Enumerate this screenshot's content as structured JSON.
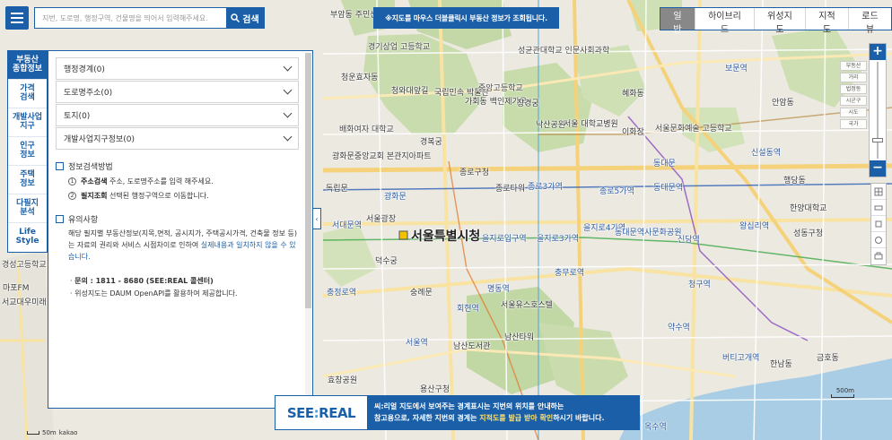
{
  "search": {
    "placeholder": "지번, 도로명, 행정구역, 건물명을 띄어서 입력해주세요.",
    "value": "",
    "button_label": "검색"
  },
  "top_notice": "※지도를 마우스 더블클릭시 부동산 정보가 조회됩니다.",
  "map_types": [
    {
      "label": "일반",
      "active": true
    },
    {
      "label": "하이브리드",
      "active": false
    },
    {
      "label": "위성지도",
      "active": false
    },
    {
      "label": "지적도",
      "active": false
    },
    {
      "label": "로드뷰",
      "active": false
    }
  ],
  "sidebar": {
    "items": [
      {
        "label": "부동산\n종합정보",
        "active": true
      },
      {
        "label": "가격\n검색",
        "active": false
      },
      {
        "label": "개발사업\n지구",
        "active": false
      },
      {
        "label": "인구\n정보",
        "active": false
      },
      {
        "label": "주택\n정보",
        "active": false
      },
      {
        "label": "다필지\n분석",
        "active": false
      },
      {
        "label": "Life\nStyle",
        "active": false
      }
    ]
  },
  "panel": {
    "accordions": [
      "행정경계(0)",
      "도로명주소(0)",
      "토지(0)",
      "개발사업지구정보(0)"
    ],
    "search_method": {
      "title": "정보검색방법",
      "steps": [
        {
          "num": "1",
          "bold": "주소검색",
          "text": " 주소, 도로명주소를 입력 해주세요."
        },
        {
          "num": "2",
          "bold": "필지조회",
          "text": " 선택된 행정구역으로 이동합니다."
        }
      ]
    },
    "caution": {
      "title": "유의사항",
      "text": "해당 필지별 부동산정보(지목,면적, 공시지가, 주택공시가격, 건축물 정보 등)는 자료의 권리와 서비스 시점차이로 인하여 ",
      "highlight": "실제내용과 일치하지 않을 수 있습니다.",
      "bullets": [
        "문의 : 1811 - 8680 (SEE:REAL 콜센터)",
        "위성지도는 DAUM OpenAPI를 활용하여 제공합니다."
      ]
    }
  },
  "banner": {
    "logo_prefix": "SEE",
    "logo_colon": ":",
    "logo_suffix": "REAL",
    "line1": "씨:리얼 지도에서 보여주는 경계표시는 지번의 위치를 안내하는",
    "line2_a": "참고용으로, 자세한 지번의 경계는 ",
    "line2_em": "지적도를 발급 받아 확인",
    "line2_b": "하시기 바랍니다."
  },
  "zoom_levels": [
    "부동산",
    "거리",
    "법정동",
    "시군구",
    "시도",
    "국가"
  ],
  "scale": {
    "left": "50m",
    "left_brand": "kakao",
    "right": "500m"
  },
  "map_labels": [
    {
      "text": "서울특별시청",
      "cls": "big"
    },
    {
      "text": "부암동\n주민센터"
    },
    {
      "text": "경기상업\n고등학교"
    },
    {
      "text": "청운효자동"
    },
    {
      "text": "청와대앞길"
    },
    {
      "text": "국립민속\n박물관"
    },
    {
      "text": "가회동\n백인제가옥"
    },
    {
      "text": "중앙고등학교"
    },
    {
      "text": "성균관대학교\n인문사회과학"
    },
    {
      "text": "혜화동"
    },
    {
      "text": "창경궁"
    },
    {
      "text": "낙산공원"
    },
    {
      "text": "서울\n대학교병원"
    },
    {
      "text": "이화장"
    },
    {
      "text": "서울문화예술\n고등학교"
    },
    {
      "text": "동대문"
    },
    {
      "text": "경복궁"
    },
    {
      "text": "배화여자\n대학교"
    },
    {
      "text": "광화문"
    },
    {
      "text": "광화문중앙교회\n본관지아파트"
    },
    {
      "text": "종로구청"
    },
    {
      "text": "종로3가역"
    },
    {
      "text": "종로타워"
    },
    {
      "text": "종로5가역"
    },
    {
      "text": "동대문역"
    },
    {
      "text": "서울광장"
    },
    {
      "text": "덕수궁"
    },
    {
      "text": "을지로입구역"
    },
    {
      "text": "을지로3가역"
    },
    {
      "text": "을지로4가역"
    },
    {
      "text": "동대문역사문화공원"
    },
    {
      "text": "신당역"
    },
    {
      "text": "청구역"
    },
    {
      "text": "약수역"
    },
    {
      "text": "충무로역"
    },
    {
      "text": "명동역"
    },
    {
      "text": "남산타워"
    },
    {
      "text": "서울역"
    },
    {
      "text": "숭례문"
    },
    {
      "text": "회현역"
    },
    {
      "text": "독립문"
    },
    {
      "text": "서대문역"
    },
    {
      "text": "충정로역"
    },
    {
      "text": "효창공원"
    },
    {
      "text": "남산도서관"
    },
    {
      "text": "서울유스호스텔"
    },
    {
      "text": "한남동"
    },
    {
      "text": "용산구청"
    },
    {
      "text": "왕십리역"
    },
    {
      "text": "한양대학교"
    },
    {
      "text": "성동구청"
    },
    {
      "text": "행당동"
    },
    {
      "text": "신설동역"
    },
    {
      "text": "보문역"
    },
    {
      "text": "안암동"
    },
    {
      "text": "마포FM"
    },
    {
      "text": "서교대우미래\n사랑아파트"
    },
    {
      "text": "경성고등학교"
    },
    {
      "text": "금호동"
    },
    {
      "text": "옥수역"
    },
    {
      "text": "버티고개역"
    }
  ]
}
